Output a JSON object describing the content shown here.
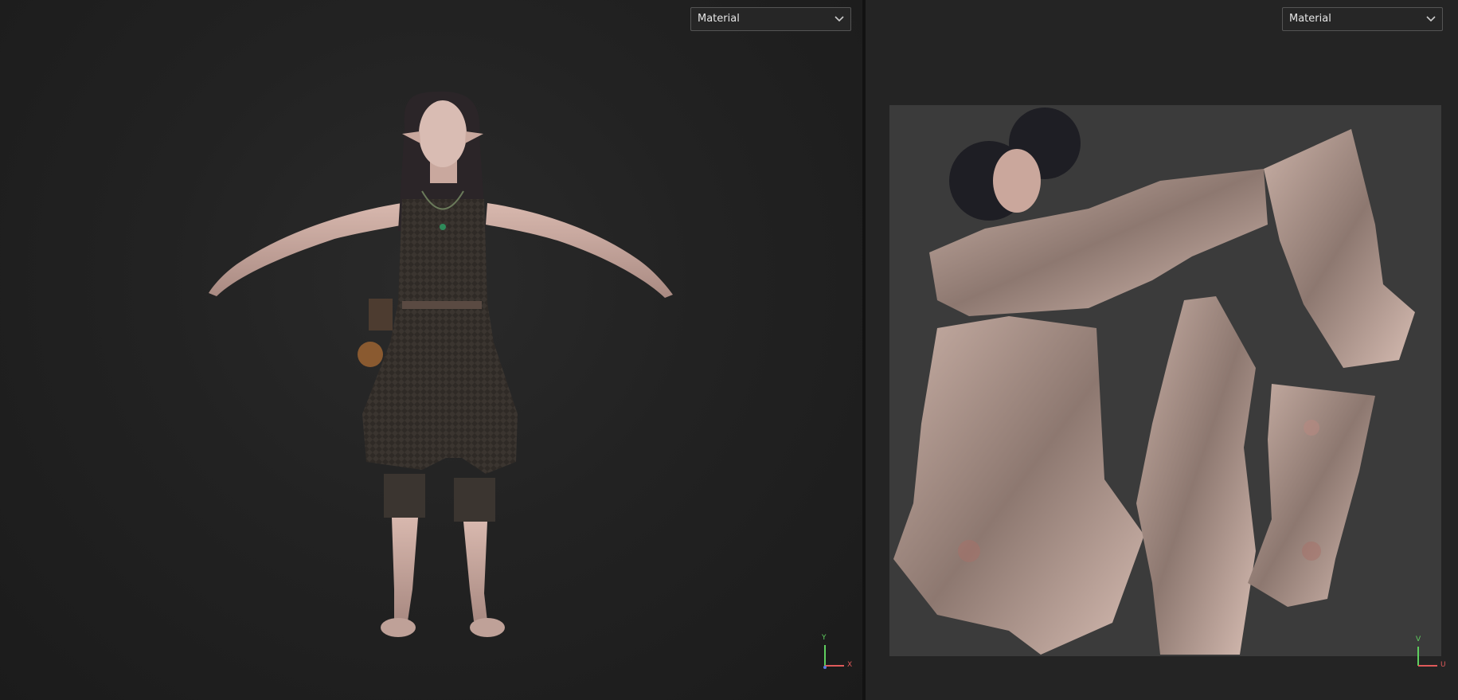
{
  "viewport_3d": {
    "shading_dropdown": {
      "selected": "Material",
      "chevron_icon": "chevron-down-icon"
    },
    "axis_gizmo": {
      "x_label": "X",
      "y_label": "Y",
      "x_color": "#e05a5a",
      "y_color": "#5fcf5f",
      "z_color": "#5a7be0"
    },
    "content": "elf-character-t-pose-model"
  },
  "viewport_uv": {
    "shading_dropdown": {
      "selected": "Material",
      "chevron_icon": "chevron-down-icon"
    },
    "axis_gizmo": {
      "u_label": "U",
      "v_label": "V",
      "u_color": "#e05a5a",
      "v_color": "#5fcf5f"
    },
    "content": "skin-texture-uv-layout"
  },
  "colors": {
    "background": "#1c1c1c",
    "uv_canvas": "#3b3b3b",
    "dropdown_border": "#555555"
  }
}
